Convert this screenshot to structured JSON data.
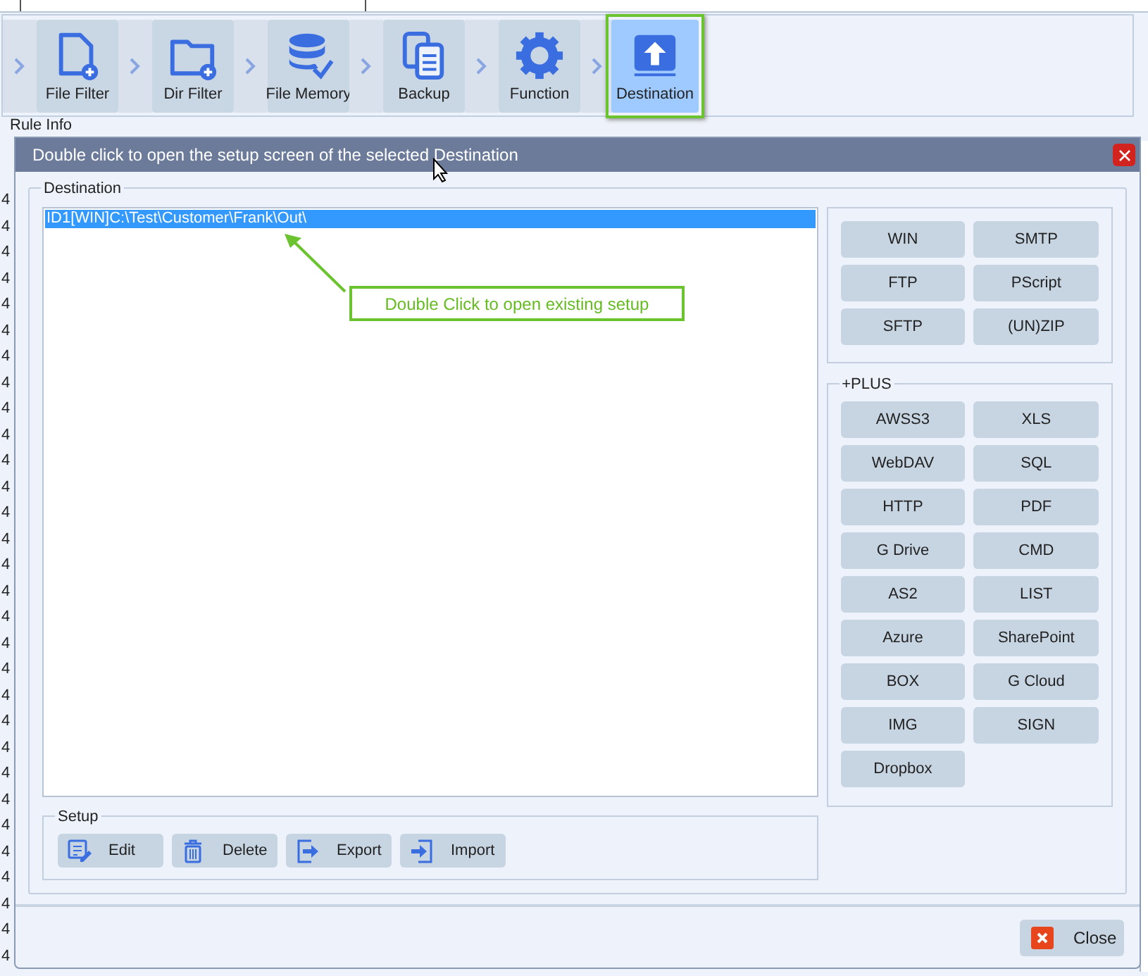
{
  "background": {
    "rule_info": "Rule Info",
    "left_column": [
      "4",
      "4",
      "4",
      "4",
      "4",
      "4",
      "4",
      "4",
      "4",
      "4",
      "4",
      "4",
      "4",
      "4",
      "4",
      "4",
      "4",
      "4",
      "4",
      "4",
      "4",
      "4",
      "4",
      "4",
      "4",
      "4",
      "4",
      "4",
      "4",
      "4"
    ]
  },
  "toolbar": [
    {
      "label": "File Filter",
      "kind": "file",
      "selected": false
    },
    {
      "label": "Dir Filter",
      "kind": "folder",
      "selected": false
    },
    {
      "label": "File Memory",
      "kind": "database",
      "selected": false
    },
    {
      "label": "Backup",
      "kind": "copy",
      "selected": false
    },
    {
      "label": "Function",
      "kind": "gear",
      "selected": false
    },
    {
      "label": "Destination",
      "kind": "upload",
      "selected": true
    }
  ],
  "dialog": {
    "title": "Double click to open the setup screen of the selected Destination",
    "destination_group": "Destination",
    "destinations": [
      {
        "text": "ID1[WIN]C:\\Test\\Customer\\Frank\\Out\\",
        "selected": true
      }
    ],
    "callout": "Double Click to open existing setup",
    "types": [
      "WIN",
      "SMTP",
      "FTP",
      "PScript",
      "SFTP",
      "(UN)ZIP"
    ],
    "plus_group": "+PLUS",
    "plus_types": [
      "AWSS3",
      "XLS",
      "WebDAV",
      "SQL",
      "HTTP",
      "PDF",
      "G Drive",
      "CMD",
      "AS2",
      "LIST",
      "Azure",
      "SharePoint",
      "BOX",
      "G Cloud",
      "IMG",
      "SIGN",
      "Dropbox"
    ],
    "setup_group": "Setup",
    "setup_buttons": [
      {
        "label": "Edit",
        "kind": "edit"
      },
      {
        "label": "Delete",
        "kind": "delete"
      },
      {
        "label": "Export",
        "kind": "export"
      },
      {
        "label": "Import",
        "kind": "import"
      }
    ],
    "close": "Close"
  }
}
